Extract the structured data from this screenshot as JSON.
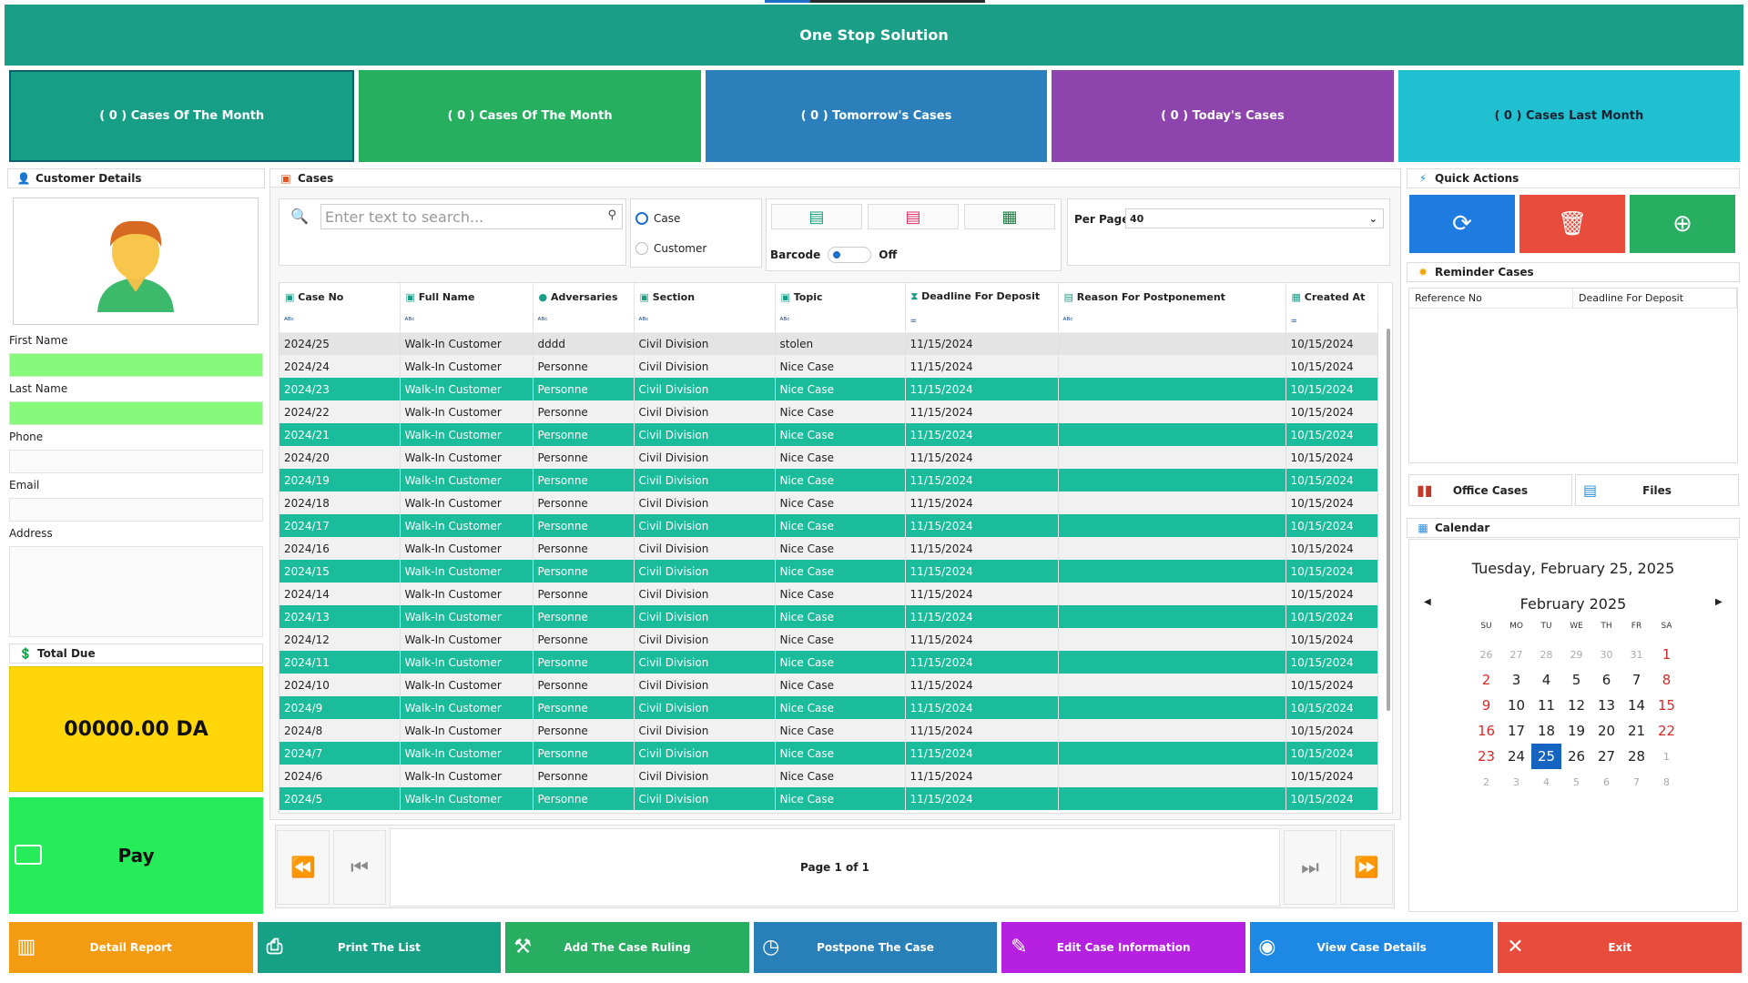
{
  "app": {
    "title": "One Stop Solution"
  },
  "stats": [
    {
      "label": "( 0 ) Cases Of The Month"
    },
    {
      "label": "( 0 ) Cases Of The Month"
    },
    {
      "label": "( 0 ) Tomorrow's Cases"
    },
    {
      "label": "( 0 ) Today's Cases"
    },
    {
      "label": "( 0 ) Cases Last Month"
    }
  ],
  "customer": {
    "title": "Customer Details",
    "first_name_label": "First Name",
    "last_name_label": "Last Name",
    "phone_label": "Phone",
    "email_label": "Email",
    "address_label": "Address",
    "total_title": "Total Due",
    "total_value": "00000.00 DA",
    "pay_label": "Pay"
  },
  "cases": {
    "title": "Cases",
    "search_placeholder": "Enter text to search...",
    "radio_case": "Case",
    "radio_customer": "Customer",
    "barcode_label": "Barcode",
    "barcode_state": "Off",
    "per_page_label": "Per Page",
    "per_page_value": "40",
    "columns": [
      "Case No",
      "Full Name",
      "Adversaries",
      "Section",
      "Topic",
      "Deadline For Deposit",
      "Reason For Postponement",
      "Created At"
    ],
    "rows": [
      [
        "2024/25",
        "Walk-In Customer",
        "dddd",
        "Civil Division",
        "stolen",
        "11/15/2024",
        "",
        "10/15/2024"
      ],
      [
        "2024/24",
        "Walk-In Customer",
        "Personne",
        "Civil Division",
        "Nice Case",
        "11/15/2024",
        "",
        "10/15/2024"
      ],
      [
        "2024/23",
        "Walk-In Customer",
        "Personne",
        "Civil Division",
        "Nice Case",
        "11/15/2024",
        "",
        "10/15/2024"
      ],
      [
        "2024/22",
        "Walk-In Customer",
        "Personne",
        "Civil Division",
        "Nice Case",
        "11/15/2024",
        "",
        "10/15/2024"
      ],
      [
        "2024/21",
        "Walk-In Customer",
        "Personne",
        "Civil Division",
        "Nice Case",
        "11/15/2024",
        "",
        "10/15/2024"
      ],
      [
        "2024/20",
        "Walk-In Customer",
        "Personne",
        "Civil Division",
        "Nice Case",
        "11/15/2024",
        "",
        "10/15/2024"
      ],
      [
        "2024/19",
        "Walk-In Customer",
        "Personne",
        "Civil Division",
        "Nice Case",
        "11/15/2024",
        "",
        "10/15/2024"
      ],
      [
        "2024/18",
        "Walk-In Customer",
        "Personne",
        "Civil Division",
        "Nice Case",
        "11/15/2024",
        "",
        "10/15/2024"
      ],
      [
        "2024/17",
        "Walk-In Customer",
        "Personne",
        "Civil Division",
        "Nice Case",
        "11/15/2024",
        "",
        "10/15/2024"
      ],
      [
        "2024/16",
        "Walk-In Customer",
        "Personne",
        "Civil Division",
        "Nice Case",
        "11/15/2024",
        "",
        "10/15/2024"
      ],
      [
        "2024/15",
        "Walk-In Customer",
        "Personne",
        "Civil Division",
        "Nice Case",
        "11/15/2024",
        "",
        "10/15/2024"
      ],
      [
        "2024/14",
        "Walk-In Customer",
        "Personne",
        "Civil Division",
        "Nice Case",
        "11/15/2024",
        "",
        "10/15/2024"
      ],
      [
        "2024/13",
        "Walk-In Customer",
        "Personne",
        "Civil Division",
        "Nice Case",
        "11/15/2024",
        "",
        "10/15/2024"
      ],
      [
        "2024/12",
        "Walk-In Customer",
        "Personne",
        "Civil Division",
        "Nice Case",
        "11/15/2024",
        "",
        "10/15/2024"
      ],
      [
        "2024/11",
        "Walk-In Customer",
        "Personne",
        "Civil Division",
        "Nice Case",
        "11/15/2024",
        "",
        "10/15/2024"
      ],
      [
        "2024/10",
        "Walk-In Customer",
        "Personne",
        "Civil Division",
        "Nice Case",
        "11/15/2024",
        "",
        "10/15/2024"
      ],
      [
        "2024/9",
        "Walk-In Customer",
        "Personne",
        "Civil Division",
        "Nice Case",
        "11/15/2024",
        "",
        "10/15/2024"
      ],
      [
        "2024/8",
        "Walk-In Customer",
        "Personne",
        "Civil Division",
        "Nice Case",
        "11/15/2024",
        "",
        "10/15/2024"
      ],
      [
        "2024/7",
        "Walk-In Customer",
        "Personne",
        "Civil Division",
        "Nice Case",
        "11/15/2024",
        "",
        "10/15/2024"
      ],
      [
        "2024/6",
        "Walk-In Customer",
        "Personne",
        "Civil Division",
        "Nice Case",
        "11/15/2024",
        "",
        "10/15/2024"
      ],
      [
        "2024/5",
        "Walk-In Customer",
        "Personne",
        "Civil Division",
        "Nice Case",
        "11/15/2024",
        "",
        "10/15/2024"
      ]
    ],
    "page_label": "Page 1 of 1"
  },
  "quick_actions": {
    "title": "Quick Actions"
  },
  "reminder": {
    "title": "Reminder Cases",
    "columns": [
      "Reference No",
      "Deadline For Deposit"
    ]
  },
  "office_cases_label": "Office Cases",
  "files_label": "Files",
  "calendar": {
    "title": "Calendar",
    "date_text": "Tuesday, February 25, 2025",
    "month_text": "February 2025",
    "day_headers": [
      "SU",
      "MO",
      "TU",
      "WE",
      "TH",
      "FR",
      "SA"
    ],
    "weeks": [
      [
        "26",
        "27",
        "28",
        "29",
        "30",
        "31",
        "1"
      ],
      [
        "2",
        "3",
        "4",
        "5",
        "6",
        "7",
        "8"
      ],
      [
        "9",
        "10",
        "11",
        "12",
        "13",
        "14",
        "15"
      ],
      [
        "16",
        "17",
        "18",
        "19",
        "20",
        "21",
        "22"
      ],
      [
        "23",
        "24",
        "25",
        "26",
        "27",
        "28",
        "1"
      ],
      [
        "2",
        "3",
        "4",
        "5",
        "6",
        "7",
        "8"
      ]
    ],
    "selected_day": "25"
  },
  "actions": [
    {
      "label": "Detail Report",
      "color": "#f39c12",
      "icon": "chart-icon"
    },
    {
      "label": "Print The List",
      "color": "#16a085",
      "icon": "printer-icon"
    },
    {
      "label": "Add The Case Ruling",
      "color": "#27ae60",
      "icon": "gavel-icon"
    },
    {
      "label": "Postpone The Case",
      "color": "#2980b9",
      "icon": "clock-icon"
    },
    {
      "label": "Edit Case Information",
      "color": "#b620e0",
      "icon": "edit-icon"
    },
    {
      "label": "View Case Details",
      "color": "#1e88e5",
      "icon": "view-icon"
    },
    {
      "label": "Exit",
      "color": "#e74c3c",
      "icon": "close-icon"
    }
  ],
  "colors": {
    "header": "#1a9e87",
    "row_accent": "#1abc9c",
    "refresh": "#1e7be0",
    "delete": "#e74c3c",
    "add": "#27ae60"
  }
}
